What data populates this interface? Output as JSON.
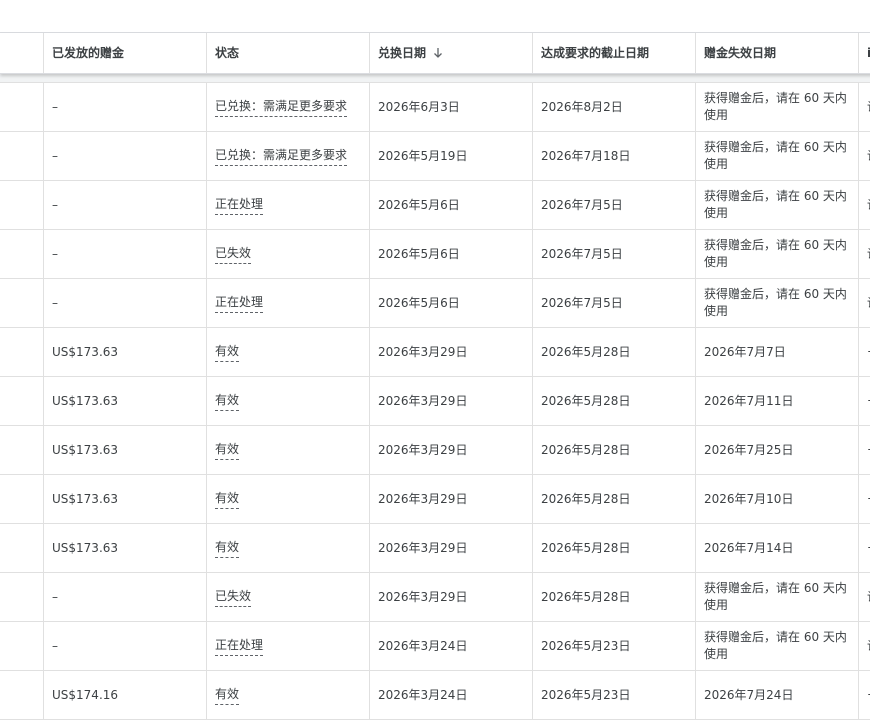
{
  "header": {
    "col_credit": "已发放的赠金",
    "col_status": "状态",
    "col_redeem_date": "兑换日期",
    "col_deadline": "达成要求的截止日期",
    "col_expiry": "赠金失效日期",
    "col_next": "i"
  },
  "rows": [
    {
      "credit": "–",
      "status": "已兑换：需满足更多要求",
      "redeem": "2026年6月3日",
      "deadline": "2026年8月2日",
      "expiry": "获得赠金后，请在 60 天内使用",
      "next": "䜣"
    },
    {
      "credit": "–",
      "status": "已兑换：需满足更多要求",
      "redeem": "2026年5月19日",
      "deadline": "2026年7月18日",
      "expiry": "获得赠金后，请在 60 天内使用",
      "next": "䜣"
    },
    {
      "credit": "–",
      "status": "正在处理",
      "redeem": "2026年5月6日",
      "deadline": "2026年7月5日",
      "expiry": "获得赠金后，请在 60 天内使用",
      "next": "䜣"
    },
    {
      "credit": "–",
      "status": "已失效",
      "redeem": "2026年5月6日",
      "deadline": "2026年7月5日",
      "expiry": "获得赠金后，请在 60 天内使用",
      "next": "䜣"
    },
    {
      "credit": "–",
      "status": "正在处理",
      "redeem": "2026年5月6日",
      "deadline": "2026年7月5日",
      "expiry": "获得赠金后，请在 60 天内使用",
      "next": "䜣"
    },
    {
      "credit": "US$173.63",
      "status": "有效",
      "redeem": "2026年3月29日",
      "deadline": "2026年5月28日",
      "expiry": "2026年7月7日",
      "next": "¬ U"
    },
    {
      "credit": "US$173.63",
      "status": "有效",
      "redeem": "2026年3月29日",
      "deadline": "2026年5月28日",
      "expiry": "2026年7月11日",
      "next": "¬ U"
    },
    {
      "credit": "US$173.63",
      "status": "有效",
      "redeem": "2026年3月29日",
      "deadline": "2026年5月28日",
      "expiry": "2026年7月25日",
      "next": "¬ U"
    },
    {
      "credit": "US$173.63",
      "status": "有效",
      "redeem": "2026年3月29日",
      "deadline": "2026年5月28日",
      "expiry": "2026年7月10日",
      "next": "¬ U"
    },
    {
      "credit": "US$173.63",
      "status": "有效",
      "redeem": "2026年3月29日",
      "deadline": "2026年5月28日",
      "expiry": "2026年7月14日",
      "next": "¬ U"
    },
    {
      "credit": "–",
      "status": "已失效",
      "redeem": "2026年3月29日",
      "deadline": "2026年5月28日",
      "expiry": "获得赠金后，请在 60 天内使用",
      "next": "䜣"
    },
    {
      "credit": "–",
      "status": "正在处理",
      "redeem": "2026年3月24日",
      "deadline": "2026年5月23日",
      "expiry": "获得赠金后，请在 60 天内使用",
      "next": "䜣"
    },
    {
      "credit": "US$174.16",
      "status": "有效",
      "redeem": "2026年3月24日",
      "deadline": "2026年5月23日",
      "expiry": "2026年7月24日",
      "next": "¬"
    }
  ]
}
